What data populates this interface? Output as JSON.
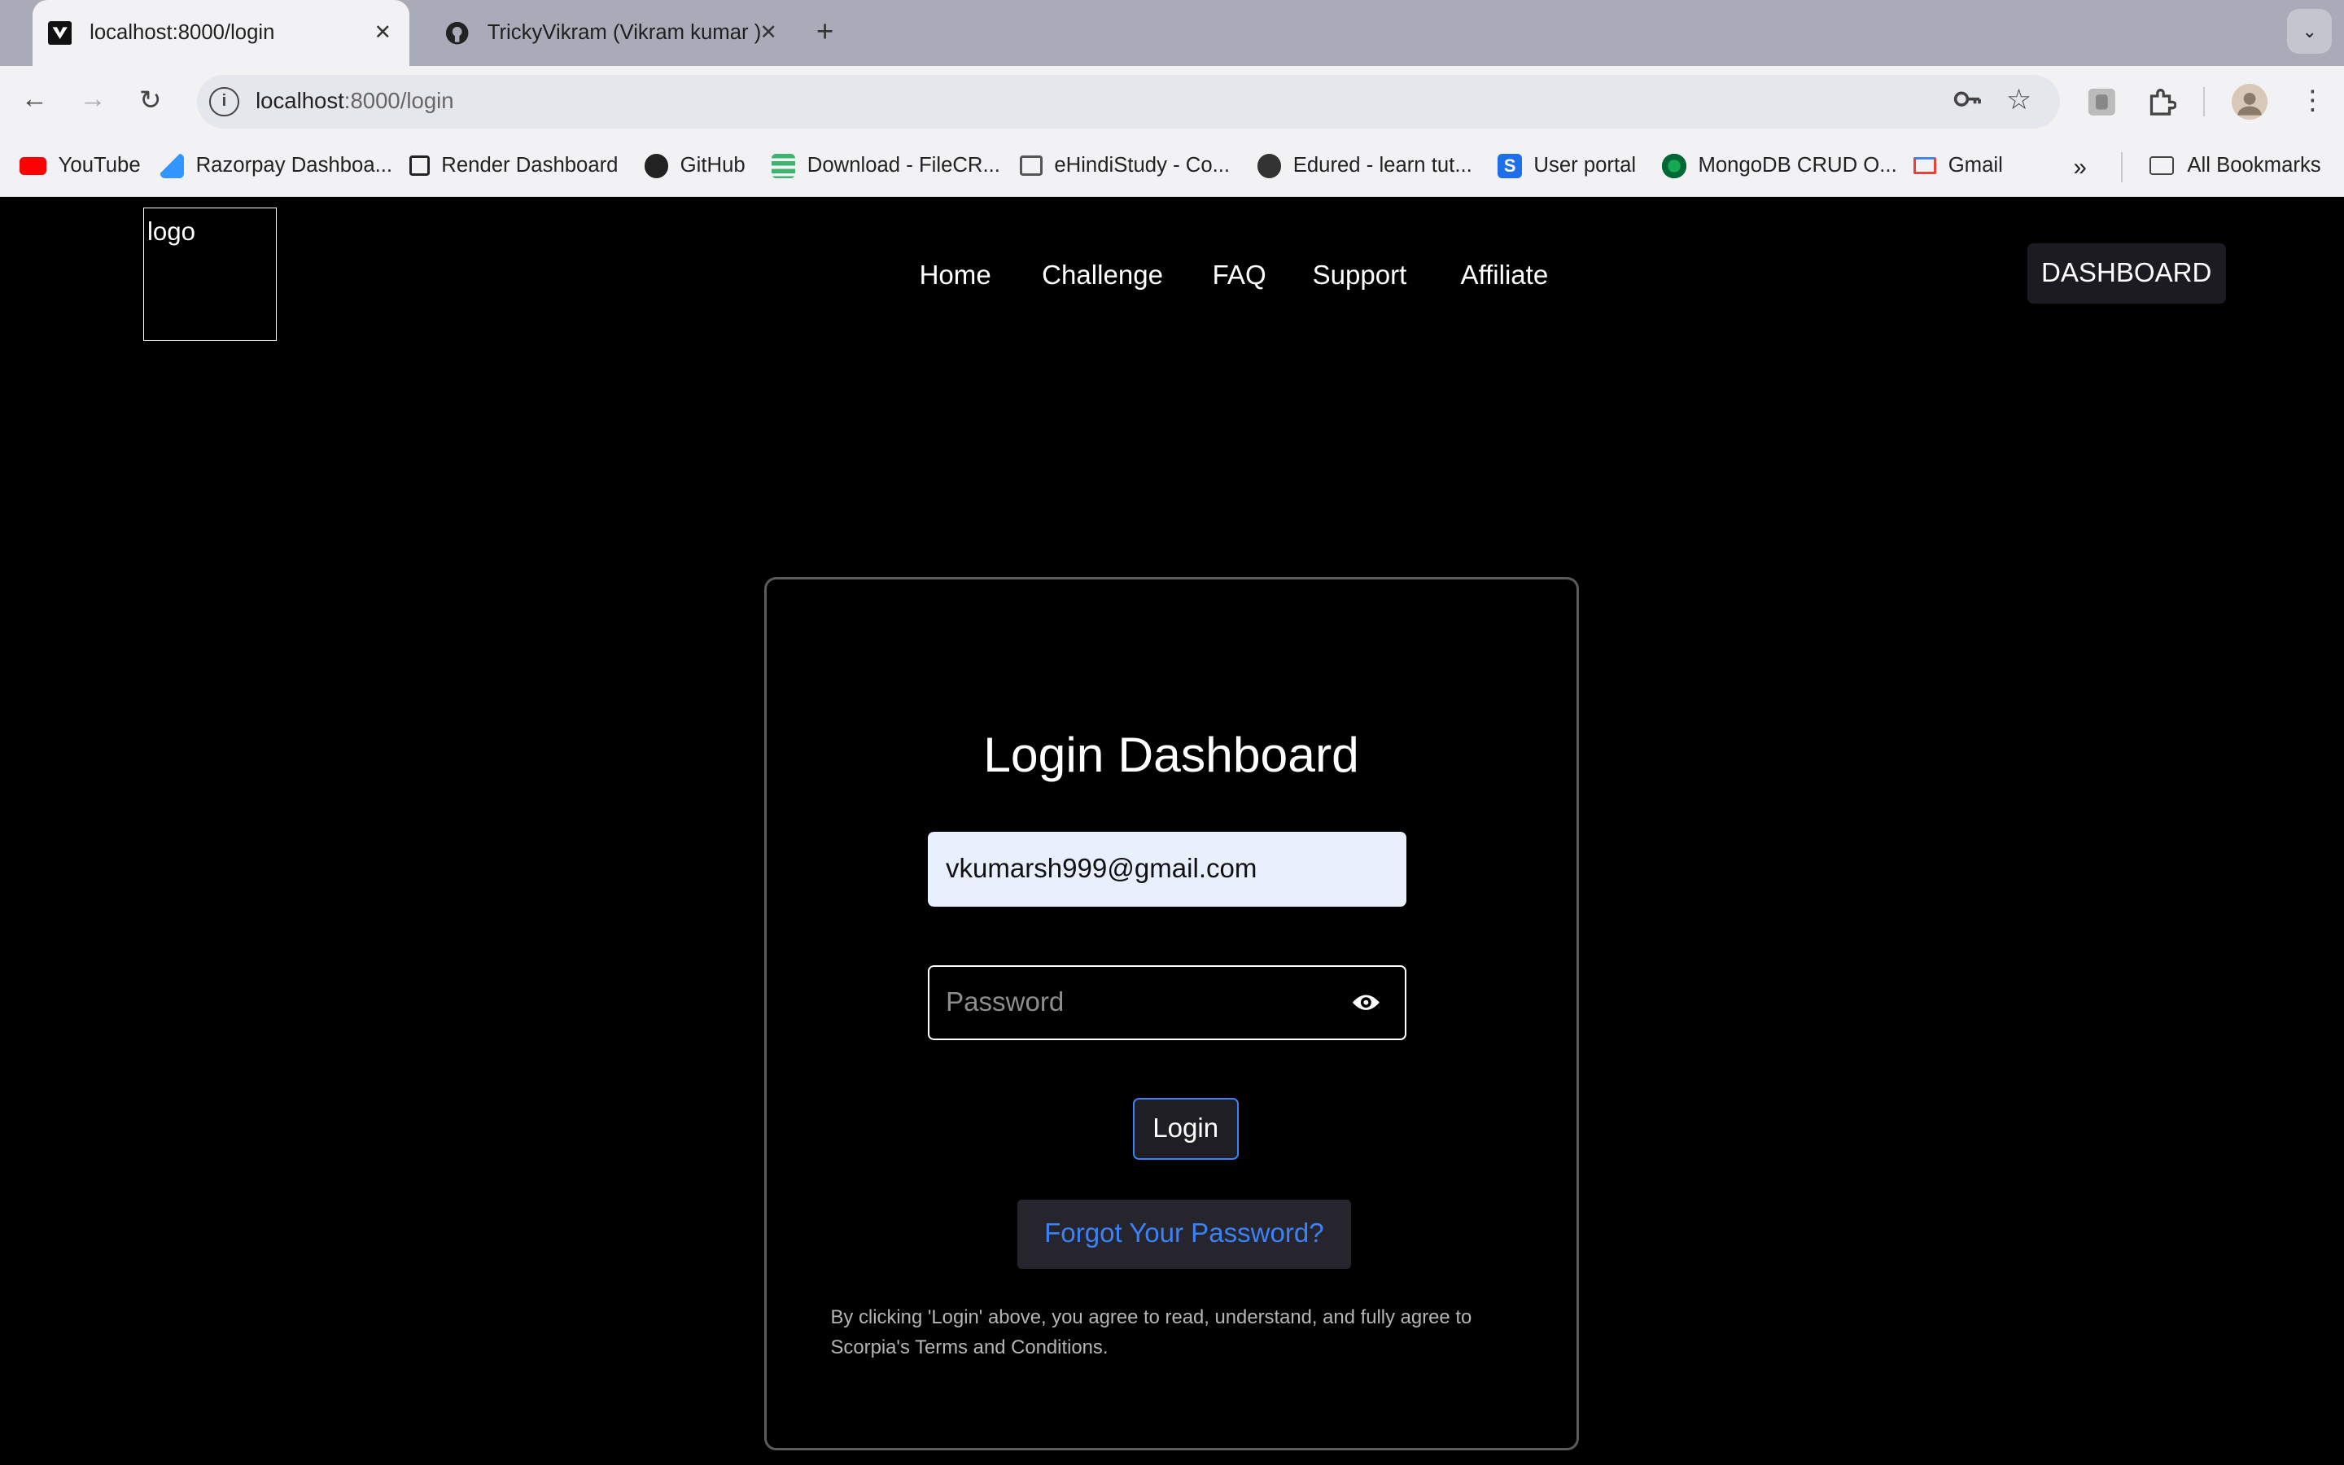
{
  "browser": {
    "tabs": [
      {
        "title": "localhost:8000/login",
        "active": true
      },
      {
        "title": "TrickyVikram (Vikram kumar )",
        "active": false
      }
    ],
    "url_host": "localhost",
    "url_path": ":8000/login",
    "bookmarks": [
      {
        "label": "YouTube",
        "color": "#ff0000"
      },
      {
        "label": "Razorpay Dashboa...",
        "color": "#3395ff"
      },
      {
        "label": "Render Dashboard",
        "color": "#222222"
      },
      {
        "label": "GitHub",
        "color": "#222222"
      },
      {
        "label": "Download - FileCR...",
        "color": "#3cb371"
      },
      {
        "label": "eHindiStudy - Co...",
        "color": "#555555"
      },
      {
        "label": "Edured - learn tut...",
        "color": "#333333"
      },
      {
        "label": "User portal",
        "color": "#1f6feb"
      },
      {
        "label": "MongoDB CRUD O...",
        "color": "#13aa52"
      },
      {
        "label": "Gmail",
        "color": "#ea4335"
      }
    ],
    "all_bookmarks": "All Bookmarks"
  },
  "site": {
    "logo_alt": "logo",
    "nav": [
      "Home",
      "Challenge",
      "FAQ",
      "Support",
      "Affiliate"
    ],
    "dashboard_button": "DASHBOARD"
  },
  "login": {
    "title": "Login Dashboard",
    "email_value": "vkumarsh999@gmail.com",
    "password_placeholder": "Password",
    "login_button": "Login",
    "forgot_button": "Forgot Your Password?",
    "terms": "By clicking 'Login' above, you agree to read, understand, and fully agree to Scorpia's Terms and Conditions."
  },
  "colors": {
    "accent": "#3b82f6",
    "background": "#000000",
    "autofill": "#e8f0fe"
  }
}
